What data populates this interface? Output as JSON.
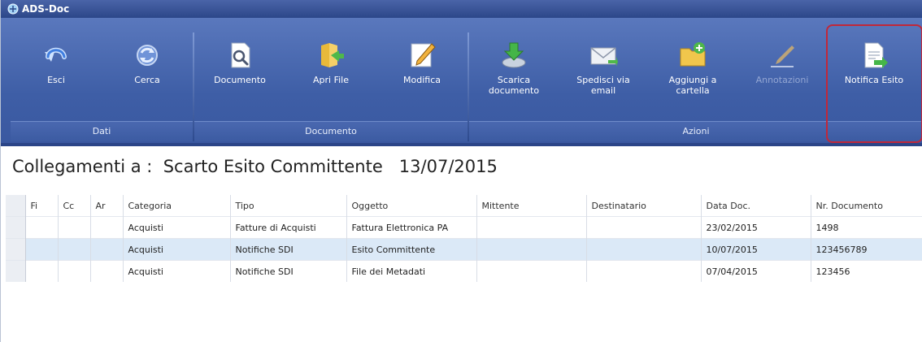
{
  "window": {
    "title": "ADS-Doc"
  },
  "ribbon": {
    "groups": [
      {
        "label": "Dati"
      },
      {
        "label": "Documento"
      },
      {
        "label": "Azioni"
      }
    ],
    "buttons": {
      "esci": {
        "label": "Esci",
        "icon": "undo-arrow-icon"
      },
      "cerca": {
        "label": "Cerca",
        "icon": "refresh-icon"
      },
      "documento": {
        "label": "Documento",
        "icon": "magnifier-document-icon"
      },
      "apri_file": {
        "label": "Apri File",
        "icon": "open-folder-icon"
      },
      "modifica": {
        "label": "Modifica",
        "icon": "pencil-icon"
      },
      "scarica": {
        "label": "Scarica\ndocumento",
        "icon": "download-icon"
      },
      "spedisci": {
        "label": "Spedisci via\nemail",
        "icon": "envelope-icon"
      },
      "aggiungi": {
        "label": "Aggiungi a\ncartella",
        "icon": "folder-add-icon"
      },
      "annotazioni": {
        "label": "Annotazioni",
        "icon": "annotation-pen-icon",
        "enabled": false
      },
      "notifica": {
        "label": "Notifica Esito",
        "icon": "notify-document-icon"
      }
    }
  },
  "heading": {
    "prefix": "Collegamenti a :",
    "subject": "Scarto Esito Committente",
    "date": "13/07/2015"
  },
  "table": {
    "columns": [
      "Fi",
      "Cc",
      "Ar",
      "Categoria",
      "Tipo",
      "Oggetto",
      "Mittente",
      "Destinatario",
      "Data Doc.",
      "Nr. Documento"
    ],
    "rows": [
      [
        "",
        "",
        "",
        "Acquisti",
        "Fatture di Acquisti",
        "Fattura Elettronica PA",
        "",
        "",
        "23/02/2015",
        "1498"
      ],
      [
        "",
        "",
        "",
        "Acquisti",
        "Notifiche SDI",
        "Esito Committente",
        "",
        "",
        "10/07/2015",
        "123456789"
      ],
      [
        "",
        "",
        "",
        "Acquisti",
        "Notifiche SDI",
        "File dei Metadati",
        "",
        "",
        "07/04/2015",
        "123456"
      ]
    ],
    "selected_row": 1
  },
  "colors": {
    "ribbon": "#3e5ea6",
    "titlebar": "#2c4789",
    "highlight": "#c0283a",
    "selected_row": "#dbe9f7"
  }
}
